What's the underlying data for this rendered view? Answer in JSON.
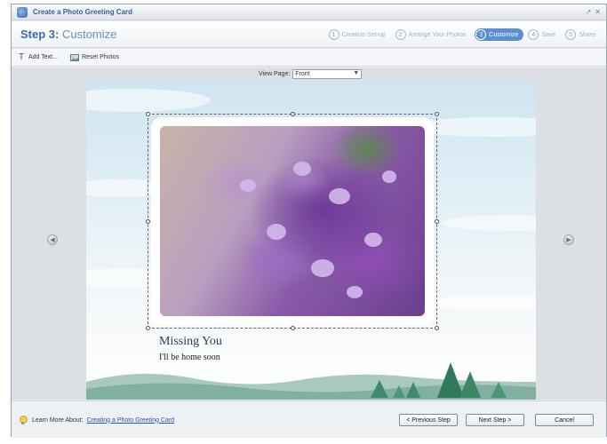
{
  "window": {
    "title": "Create a Photo Greeting Card",
    "controls": [
      "↗",
      "✕"
    ]
  },
  "header": {
    "step_prefix": "Step 3:",
    "step_name": "Customize",
    "steps": [
      {
        "num": "1",
        "label": "Creation Set-up"
      },
      {
        "num": "2",
        "label": "Arrange Your Photos"
      },
      {
        "num": "3",
        "label": "Customize",
        "active": true
      },
      {
        "num": "4",
        "label": "Save"
      },
      {
        "num": "5",
        "label": "Share"
      }
    ]
  },
  "toolbar": {
    "add_text": "Add Text...",
    "reset_photos": "Reset Photos"
  },
  "view_page": {
    "label": "View Page:",
    "value": "Front"
  },
  "card": {
    "title": "Missing You",
    "subtitle": "I'll be home soon"
  },
  "footer": {
    "learn_label": "Learn More About:",
    "learn_link": "Creating a Photo Greeting Card",
    "prev": "< Previous Step",
    "next": "Next Step >",
    "cancel": "Cancel"
  },
  "colors": {
    "accent": "#5a8fd3",
    "title_blue": "#3f6aa8"
  }
}
